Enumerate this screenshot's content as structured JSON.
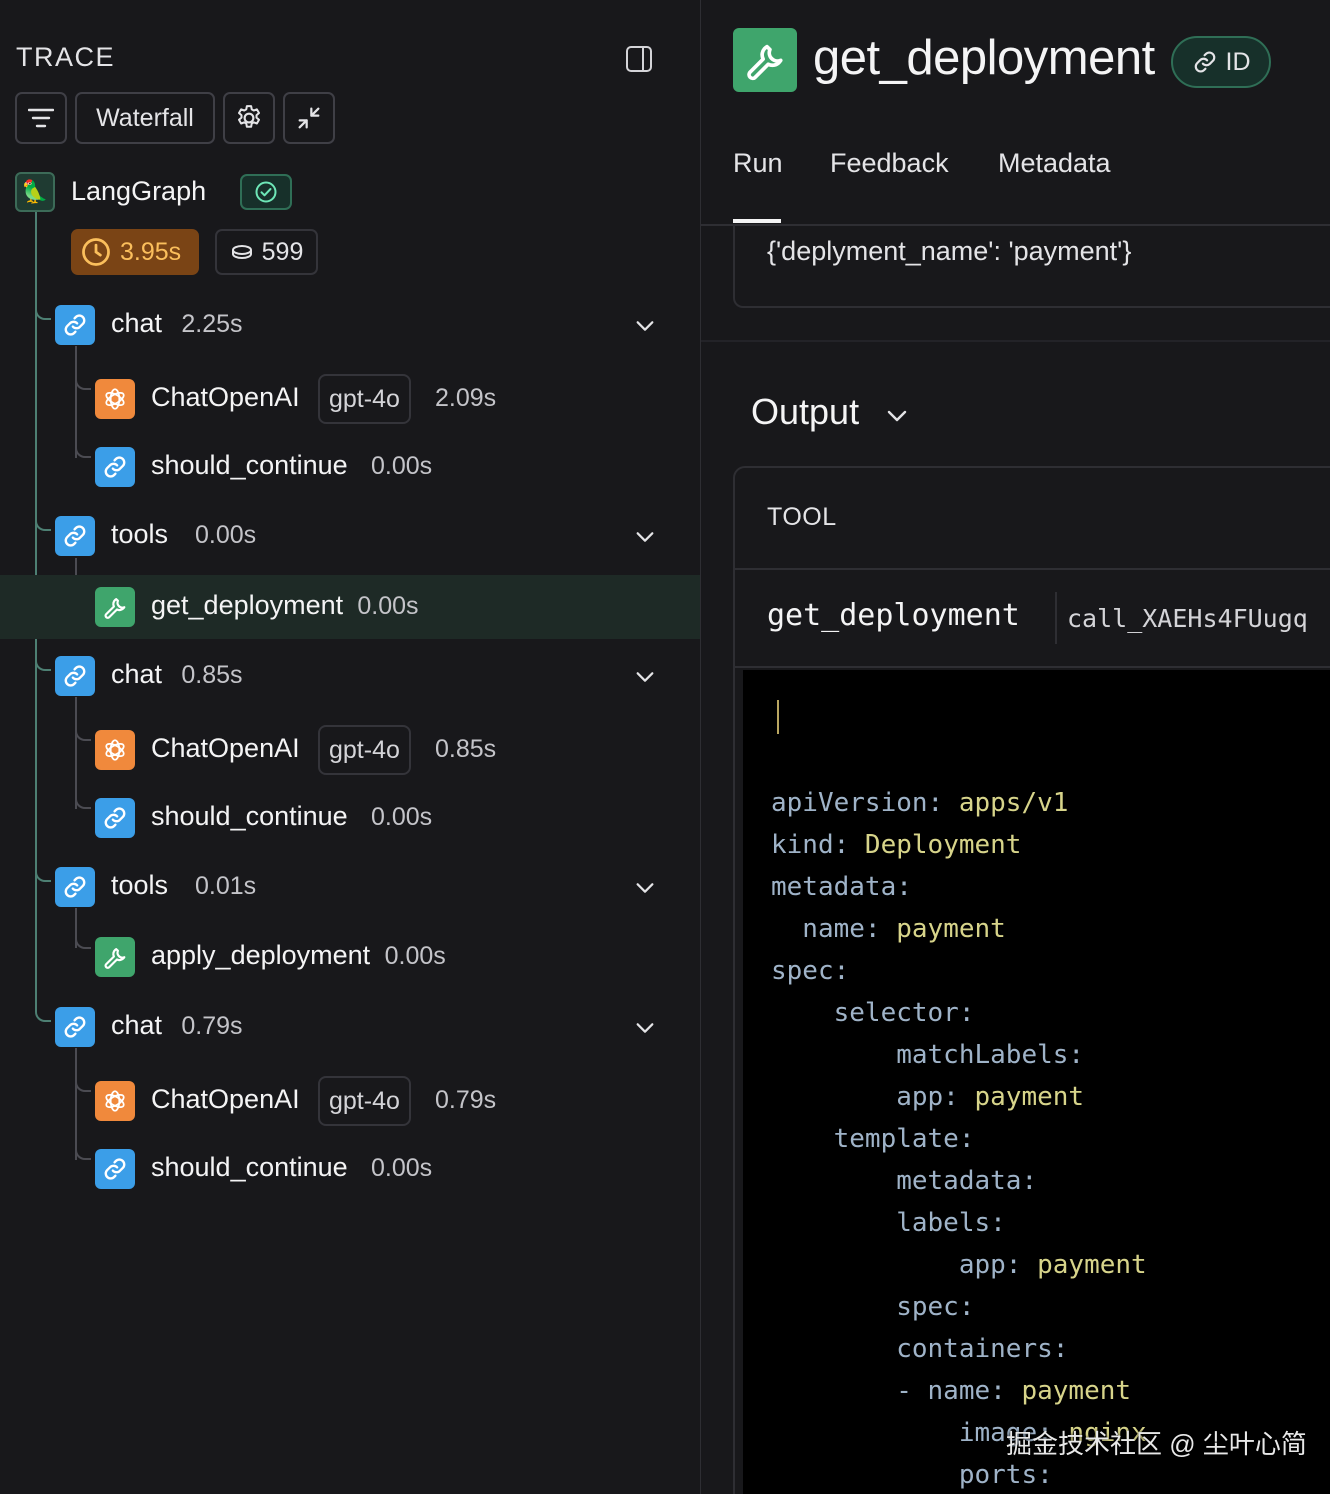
{
  "left": {
    "title": "TRACE",
    "toolbar": {
      "view_label": "Waterfall"
    },
    "root": {
      "name": "LangGraph",
      "latency": "3.95s",
      "tokens": "599"
    },
    "runs": [
      {
        "name": "chat",
        "dur": "2.25s",
        "type": "chain"
      },
      {
        "name": "ChatOpenAI",
        "model": "gpt-4o",
        "dur": "2.09s",
        "type": "llm"
      },
      {
        "name": "should_continue",
        "dur": "0.00s",
        "type": "chain"
      },
      {
        "name": "tools",
        "dur": "0.00s",
        "type": "chain"
      },
      {
        "name": "get_deployment",
        "dur": "0.00s",
        "type": "tool",
        "selected": true
      },
      {
        "name": "chat",
        "dur": "0.85s",
        "type": "chain"
      },
      {
        "name": "ChatOpenAI",
        "model": "gpt-4o",
        "dur": "0.85s",
        "type": "llm"
      },
      {
        "name": "should_continue",
        "dur": "0.00s",
        "type": "chain"
      },
      {
        "name": "tools",
        "dur": "0.01s",
        "type": "chain"
      },
      {
        "name": "apply_deployment",
        "dur": "0.00s",
        "type": "tool"
      },
      {
        "name": "chat",
        "dur": "0.79s",
        "type": "chain"
      },
      {
        "name": "ChatOpenAI",
        "model": "gpt-4o",
        "dur": "0.79s",
        "type": "llm"
      },
      {
        "name": "should_continue",
        "dur": "0.00s",
        "type": "chain"
      }
    ]
  },
  "right": {
    "title": "get_deployment",
    "id_label": "ID",
    "tabs": [
      "Run",
      "Feedback",
      "Metadata"
    ],
    "input_text": "{'deplyment_name': 'payment'}",
    "output_label": "Output",
    "tool_label": "TOOL",
    "tool_name": "get_deployment",
    "call_id": "call_XAEHs4FUugq",
    "code": [
      {
        "k": "apiVersion: ",
        "v": "apps/v1"
      },
      {
        "k": "kind: ",
        "v": "Deployment"
      },
      {
        "k": "metadata:",
        "v": ""
      },
      {
        "k": "  name: ",
        "v": "payment"
      },
      {
        "k": "spec:",
        "v": ""
      },
      {
        "k": "    selector:",
        "v": ""
      },
      {
        "k": "        matchLabels:",
        "v": ""
      },
      {
        "k": "        app: ",
        "v": "payment"
      },
      {
        "k": "    template:",
        "v": ""
      },
      {
        "k": "        metadata:",
        "v": ""
      },
      {
        "k": "        labels:",
        "v": ""
      },
      {
        "k": "            app: ",
        "v": "payment"
      },
      {
        "k": "        spec:",
        "v": ""
      },
      {
        "k": "        containers:",
        "v": ""
      },
      {
        "k": "        - name: ",
        "v": "payment"
      },
      {
        "k": "            image: ",
        "v": "nginx"
      },
      {
        "k": "            ports:",
        "v": ""
      }
    ]
  },
  "watermark": "掘金技术社区 @ 尘叶心简"
}
